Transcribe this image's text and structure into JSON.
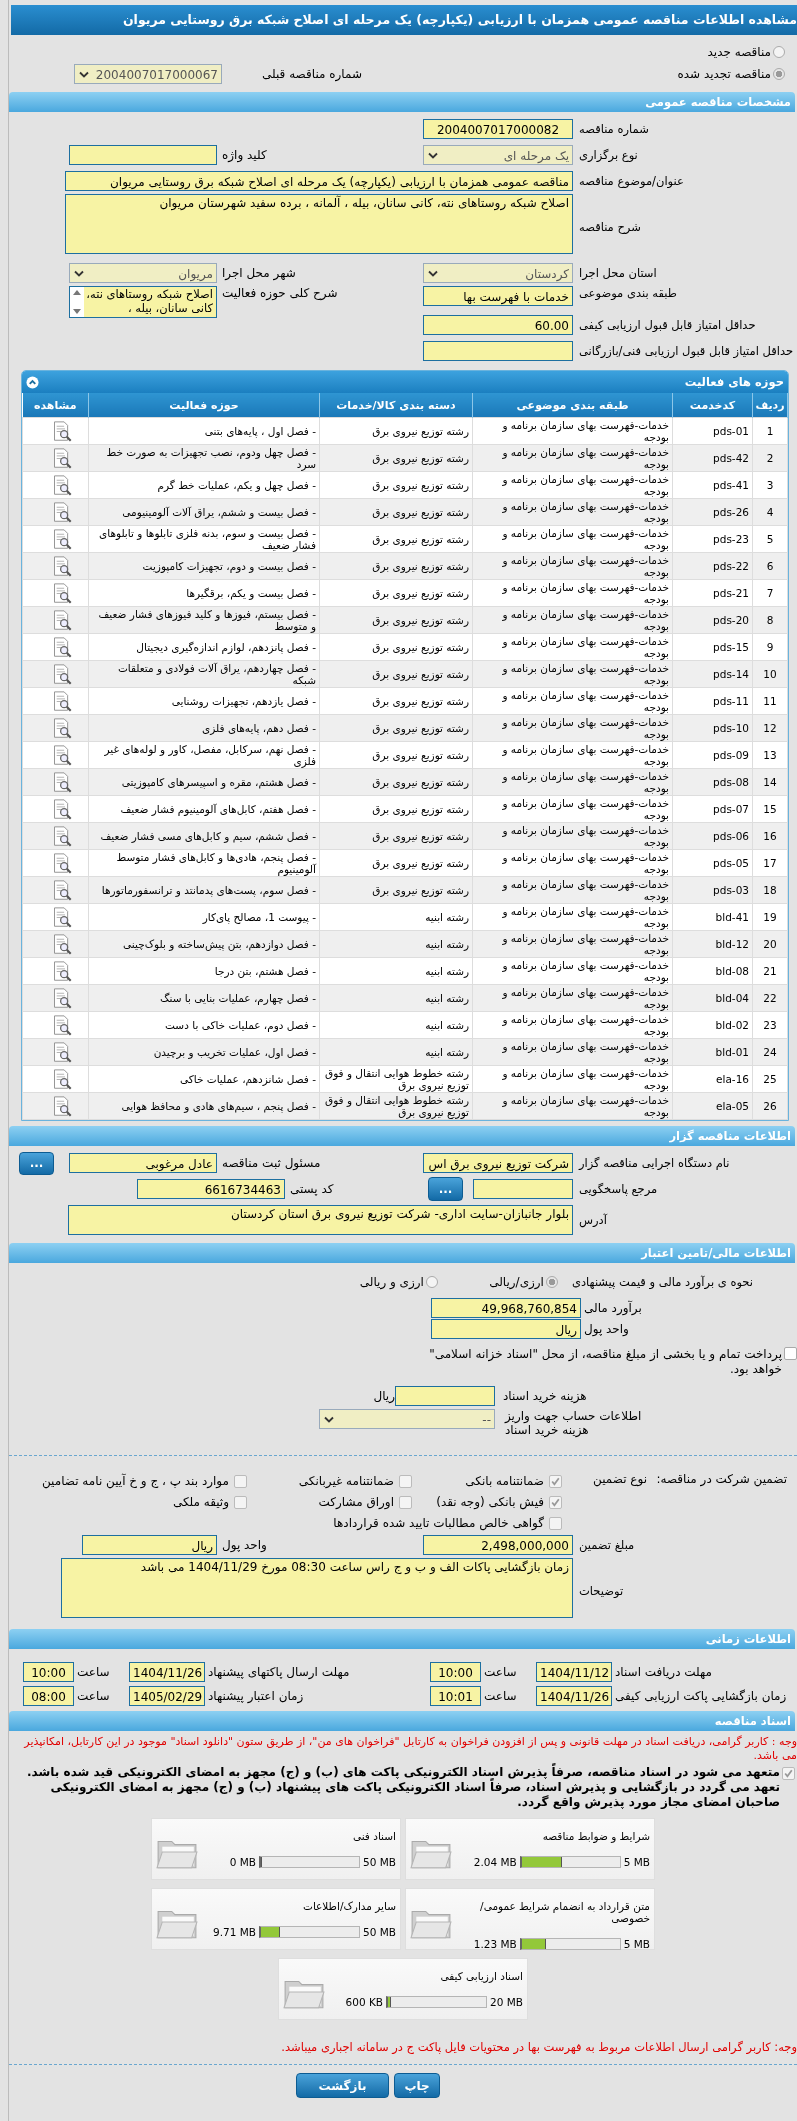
{
  "page_title": "مشاهده اطلاعات مناقصه عمومی همزمان با ارزیابی (یکپارچه) یک مرحله ای اصلاح شبکه برق روستایی مریوان",
  "tender_type": [
    {
      "label": "مناقصه جدید",
      "selected": false
    },
    {
      "label": "مناقصه تجدید شده",
      "selected": true
    }
  ],
  "previous_tender": {
    "label": "شماره مناقصه قبلی",
    "value": "2004007017000067"
  },
  "general": {
    "title": "مشخصات مناقصه عمومی",
    "tender_number": {
      "label": "شماره مناقصه",
      "value": "2004007017000082"
    },
    "holding_type": {
      "label": "نوع برگزاری",
      "value": "یک مرحله ای"
    },
    "keyword": {
      "label": "کلید واژه"
    },
    "subject": {
      "label": "عنوان/موضوع مناقصه",
      "value": "مناقصه عمومی همزمان با ارزیابی (یکپارچه) یک مرحله ای اصلاح شبکه برق روستایی مریوان"
    },
    "description": {
      "label": "شرح مناقصه",
      "value": "اصلاح شبکه روستاهای نته، کانی سانان، بیله ، آلمانه ، برده سفید شهرستان مریوان"
    },
    "province": {
      "label": "استان محل اجرا",
      "value": "کردستان"
    },
    "city": {
      "label": "شهر محل اجرا",
      "value": "مریوان"
    },
    "category": {
      "label": "طبقه بندی موضوعی",
      "value": "خدمات با فهرست بها"
    },
    "activity_summary": {
      "label": "شرح کلی حوزه فعالیت",
      "value": "اصلاح شبکه روستاهای نته، کانی سانان، بیله ،"
    },
    "min_quality_score": {
      "label": "حداقل امتیاز قابل قبول ارزیابی کیفی",
      "value": "60.00"
    },
    "min_technical_score": {
      "label": "حداقل امتیاز قابل قبول ارزیابی فنی/بازرگانی"
    }
  },
  "activities": {
    "title": "حوزه های فعالیت",
    "columns": [
      "ردیف",
      "کدخدمت",
      "طبقه بندی موضوعی",
      "دسته بندی کالا/خدمات",
      "حوزه فعالیت",
      "مشاهده"
    ],
    "rows": [
      {
        "index": "1",
        "code": "pds-01",
        "category": "خدمات-فهرست بهای سازمان برنامه و بودجه",
        "group": "رشته توزیع نیروی برق",
        "activity": "- فصل اول ، پایه‌های بتنی"
      },
      {
        "index": "2",
        "code": "pds-42",
        "category": "خدمات-فهرست بهای سازمان برنامه و بودجه",
        "group": "رشته توزیع نیروی برق",
        "activity": "- فصل چهل ودوم، نصب تجهیزات به صورت خط سرد"
      },
      {
        "index": "3",
        "code": "pds-41",
        "category": "خدمات-فهرست بهای سازمان برنامه و بودجه",
        "group": "رشته توزیع نیروی برق",
        "activity": "- فصل چهل و یکم، عملیات خط گرم"
      },
      {
        "index": "4",
        "code": "pds-26",
        "category": "خدمات-فهرست بهای سازمان برنامه و بودجه",
        "group": "رشته توزیع نیروی برق",
        "activity": "- فصل بیست و ششم، یراق آلات آلومینیومی"
      },
      {
        "index": "5",
        "code": "pds-23",
        "category": "خدمات-فهرست بهای سازمان برنامه و بودجه",
        "group": "رشته توزیع نیروی برق",
        "activity": "- فصل بیست و سوم، بدنه فلزی تابلوها و تابلوهای فشار ضعیف"
      },
      {
        "index": "6",
        "code": "pds-22",
        "category": "خدمات-فهرست بهای سازمان برنامه و بودجه",
        "group": "رشته توزیع نیروی برق",
        "activity": "- فصل بیست و دوم، تجهیزات کامپوزیت"
      },
      {
        "index": "7",
        "code": "pds-21",
        "category": "خدمات-فهرست بهای سازمان برنامه و بودجه",
        "group": "رشته توزیع نیروی برق",
        "activity": "- فصل بیست و یکم، برقگیرها"
      },
      {
        "index": "8",
        "code": "pds-20",
        "category": "خدمات-فهرست بهای سازمان برنامه و بودجه",
        "group": "رشته توزیع نیروی برق",
        "activity": "- فصل بیستم، فیوزها و کلید فیوزهای فشار ضعیف و متوسط"
      },
      {
        "index": "9",
        "code": "pds-15",
        "category": "خدمات-فهرست بهای سازمان برنامه و بودجه",
        "group": "رشته توزیع نیروی برق",
        "activity": "- فصل پانزدهم، لوازم اندازه‌گیری دیجیتال"
      },
      {
        "index": "10",
        "code": "pds-14",
        "category": "خدمات-فهرست بهای سازمان برنامه و بودجه",
        "group": "رشته توزیع نیروی برق",
        "activity": "- فصل چهاردهم، یراق آلات فولادی و متعلقات شبکه"
      },
      {
        "index": "11",
        "code": "pds-11",
        "category": "خدمات-فهرست بهای سازمان برنامه و بودجه",
        "group": "رشته توزیع نیروی برق",
        "activity": "- فصل یازدهم، تجهیزات روشنایی"
      },
      {
        "index": "12",
        "code": "pds-10",
        "category": "خدمات-فهرست بهای سازمان برنامه و بودجه",
        "group": "رشته توزیع نیروی برق",
        "activity": "- فصل دهم، پایه‌های فلزی"
      },
      {
        "index": "13",
        "code": "pds-09",
        "category": "خدمات-فهرست بهای سازمان برنامه و بودجه",
        "group": "رشته توزیع نیروی برق",
        "activity": "- فصل نهم، سرکابل، مفصل، کاور و لوله‌های غیر فلزی"
      },
      {
        "index": "14",
        "code": "pds-08",
        "category": "خدمات-فهرست بهای سازمان برنامه و بودجه",
        "group": "رشته توزیع نیروی برق",
        "activity": "- فصل هشتم، مقره و اسپیسرهای کامپوزیتی"
      },
      {
        "index": "15",
        "code": "pds-07",
        "category": "خدمات-فهرست بهای سازمان برنامه و بودجه",
        "group": "رشته توزیع نیروی برق",
        "activity": "- فصل هفتم، کابل‌های آلومینیوم فشار ضعیف"
      },
      {
        "index": "16",
        "code": "pds-06",
        "category": "خدمات-فهرست بهای سازمان برنامه و بودجه",
        "group": "رشته توزیع نیروی برق",
        "activity": "- فصل ششم، سیم و کابل‌های مسی فشار ضعیف"
      },
      {
        "index": "17",
        "code": "pds-05",
        "category": "خدمات-فهرست بهای سازمان برنامه و بودجه",
        "group": "رشته توزیع نیروی برق",
        "activity": "- فصل پنجم، هادی‌ها و کابل‌های فشار متوسط آلومینیوم"
      },
      {
        "index": "18",
        "code": "pds-03",
        "category": "خدمات-فهرست بهای سازمان برنامه و بودجه",
        "group": "رشته توزیع نیروی برق",
        "activity": "- فصل سوم، پست‌های پدمانتد و ترانسفورماتورها"
      },
      {
        "index": "19",
        "code": "bld-41",
        "category": "خدمات-فهرست بهای سازمان برنامه و بودجه",
        "group": "رشته ابنیه",
        "activity": "- پیوست 1، مصالح پای‌کار"
      },
      {
        "index": "20",
        "code": "bld-12",
        "category": "خدمات-فهرست بهای سازمان برنامه و بودجه",
        "group": "رشته ابنیه",
        "activity": "- فصل دوازدهم، بتن پیش‌ساخته و بلوک‌چینی"
      },
      {
        "index": "21",
        "code": "bld-08",
        "category": "خدمات-فهرست بهای سازمان برنامه و بودجه",
        "group": "رشته ابنیه",
        "activity": "- فصل هشتم، بتن درجا"
      },
      {
        "index": "22",
        "code": "bld-04",
        "category": "خدمات-فهرست بهای سازمان برنامه و بودجه",
        "group": "رشته ابنیه",
        "activity": "- فصل چهارم، عملیات بنایی با سنگ"
      },
      {
        "index": "23",
        "code": "bld-02",
        "category": "خدمات-فهرست بهای سازمان برنامه و بودجه",
        "group": "رشته ابنیه",
        "activity": "- فصل دوم، عملیات خاکی با دست"
      },
      {
        "index": "24",
        "code": "bld-01",
        "category": "خدمات-فهرست بهای سازمان برنامه و بودجه",
        "group": "رشته ابنیه",
        "activity": "- فصل اول، عملیات تخریب و برچیدن"
      },
      {
        "index": "25",
        "code": "ela-16",
        "category": "خدمات-فهرست بهای سازمان برنامه و بودجه",
        "group": "رشته خطوط هوایی انتقال و فوق توزیع نیروی برق",
        "activity": "- فصل شانزدهم، عملیات خاکی"
      },
      {
        "index": "26",
        "code": "ela-05",
        "category": "خدمات-فهرست بهای سازمان برنامه و بودجه",
        "group": "رشته خطوط هوایی انتقال و فوق توزیع نیروی برق",
        "activity": "- فصل پنجم ، سیم‌های هادی و محافظ هوایی"
      }
    ]
  },
  "organizer": {
    "title": "اطلاعات مناقصه گزار",
    "org_name": {
      "label": "نام دستگاه اجرایی مناقصه گزار",
      "value": "شرکت توزیع نیروی برق اس"
    },
    "registrar": {
      "label": "مسئول ثبت مناقصه",
      "value": "عادل مرغوبی",
      "button": "..."
    },
    "reference": {
      "label": "مرجع پاسخگویی",
      "button": "..."
    },
    "postal_code": {
      "label": "کد پستی",
      "value": "6616734463"
    },
    "address": {
      "label": "آدرس",
      "value": "بلوار جانبازان-سایت اداری- شرکت توزیع نیروی برق استان کردستان"
    }
  },
  "finance": {
    "title": "اطلاعات مالی/تامین اعتبار",
    "method": {
      "label": "نحوه ی برآورد مالی و قیمت پیشنهادی",
      "options": [
        {
          "label": "ارزی/ریالی",
          "selected": true
        },
        {
          "label": "ارزی و ریالی",
          "selected": false
        }
      ]
    },
    "estimate": {
      "label": "برآورد مالی",
      "value": "49,968,760,854"
    },
    "currency": {
      "label": "واحد پول",
      "value": "ریال"
    },
    "treasury": {
      "label": "پرداخت تمام و یا بخشی از مبلغ مناقصه، از محل \"اسناد خزانه اسلامی\" خواهد بود.",
      "checked": false
    },
    "doc_fee": {
      "label": "هزینه خرید اسناد",
      "unit": "ریال"
    },
    "account": {
      "label": "اطلاعات حساب جهت واریز هزینه خرید اسناد",
      "value": "--"
    }
  },
  "guarantee": {
    "label": "تضمین شرکت در مناقصه:",
    "type_label": "نوع تضمین",
    "types": [
      {
        "label": "ضمانتنامه بانکی",
        "checked": true
      },
      {
        "label": "ضمانتنامه غیربانکی",
        "checked": false
      },
      {
        "label": "موارد بند پ ، ج و خ آیین نامه تضامین",
        "checked": false
      },
      {
        "label": "فیش بانکی (وجه نقد)",
        "checked": true
      },
      {
        "label": "اوراق مشارکت",
        "checked": false
      },
      {
        "label": "وثیقه ملکی",
        "checked": false
      },
      {
        "label": "گواهی خالص مطالبات تایید شده قراردادها",
        "checked": false
      }
    ],
    "amount": {
      "label": "مبلغ تضمین",
      "value": "2,498,000,000"
    },
    "currency": {
      "label": "واحد پول",
      "value": "ریال"
    },
    "notes": {
      "label": "توضیحات",
      "value": "زمان بازگشایی پاکات الف و ب و ج راس ساعت 08:30 مورخ 1404/11/29 می باشد"
    }
  },
  "timing": {
    "title": "اطلاعات زمانی",
    "items": [
      {
        "label": "مهلت دریافت اسناد",
        "date": "1404/11/12",
        "time_label": "ساعت",
        "time": "10:00"
      },
      {
        "label": "مهلت ارسال پاکتهای پیشنهاد",
        "date": "1404/11/26",
        "time_label": "ساعت",
        "time": "10:00"
      },
      {
        "label": "زمان بازگشایی پاکت ارزیابی کیفی",
        "date": "1404/11/26",
        "time_label": "ساعت",
        "time": "10:01"
      },
      {
        "label": "زمان اعتبار پیشنهاد",
        "date": "1405/02/29",
        "time_label": "ساعت",
        "time": "08:00"
      }
    ]
  },
  "documents": {
    "title": "اسناد مناقصه",
    "notice": "وجه : کاربر گرامی، دریافت اسناد در مهلت قانونی و پس از افزودن فراخوان به کارتابل \"فراخوان های من\"، از طریق ستون \"دانلود اسناد\" موجود در این کارتابل، امکانپذیر می باشد.",
    "commitment": {
      "text": "متعهد می شود در اسناد مناقصه، صرفاً پذیرش اسناد الکترونیکی پاکت های (ب) و (ج) مجهز به امضای الکترونیکی قید شده باشد. تعهد می گردد در بازگشایی و پذیرش اسناد، صرفاً اسناد الکترونیکی پاکت های پیشنهاد (ب) و (ج) مجهز به امضای الکترونیکی صاحبان امضای مجاز مورد پذیرش واقع گردد.",
      "checked": true
    },
    "files": [
      {
        "name": "شرایط و ضوابط مناقصه",
        "used": "2.04 MB",
        "limit": "5 MB",
        "level": 0.41
      },
      {
        "name": "اسناد فنی",
        "used": "0 MB",
        "limit": "50 MB",
        "level": 0
      },
      {
        "name": "متن قرارداد به انضمام شرایط عمومی/خصوصی",
        "used": "1.23 MB",
        "limit": "5 MB",
        "level": 0.25
      },
      {
        "name": "سایر مدارک/اطلاعات",
        "used": "9.71 MB",
        "limit": "50 MB",
        "level": 0.19
      },
      {
        "name": "اسناد ارزیابی کیفی",
        "used": "600 KB",
        "limit": "20 MB",
        "level": 0.03
      }
    ],
    "footer_notice": "وجه: کاربر گرامی ارسال اطلاعات مربوط به فهرست بها در محتویات فایل پاکت ج در سامانه اجباری میباشد."
  },
  "buttons": [
    "چاپ",
    "بازگشت"
  ]
}
